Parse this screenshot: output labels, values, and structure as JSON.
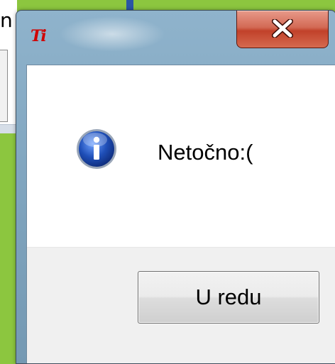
{
  "background": {
    "partial_text": "n"
  },
  "dialog": {
    "title_icon_text": "Ti",
    "close_icon": "close-x-icon",
    "message_icon": "info-icon",
    "message": "Netočno:(",
    "ok_label": "U redu"
  },
  "colors": {
    "close_button": "#c1412a",
    "info_icon_blue": "#1f4fb8",
    "desktop_green": "#8cc63f"
  }
}
